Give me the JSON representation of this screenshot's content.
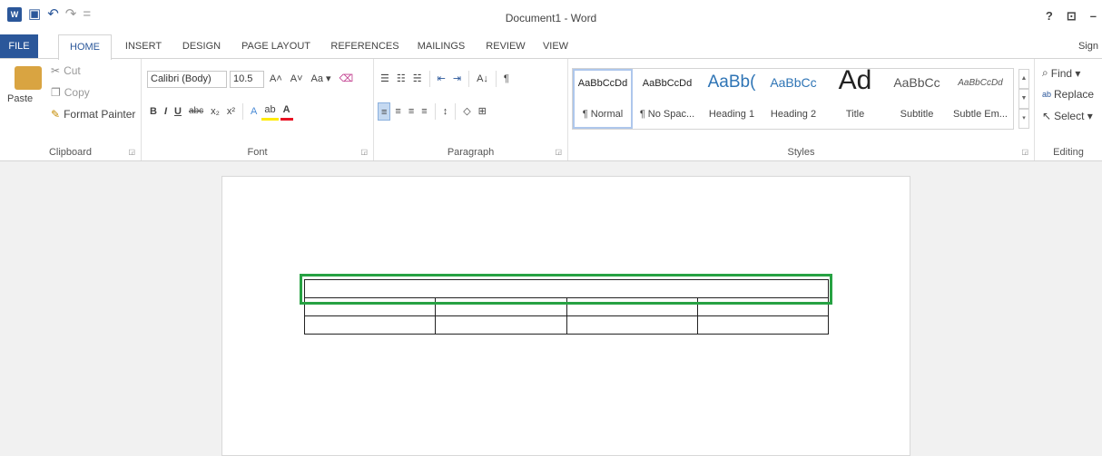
{
  "window": {
    "title": "Document1 - Word",
    "controls": [
      "?",
      "⊡",
      "–"
    ]
  },
  "qat": {
    "app_icon": "W",
    "save_icon": "💾",
    "undo_icon": "↶",
    "redo_icon": "↷",
    "customize_icon": "="
  },
  "tabs": {
    "file": "FILE",
    "home": "HOME",
    "insert": "INSERT",
    "design": "DESIGN",
    "page_layout": "PAGE LAYOUT",
    "references": "REFERENCES",
    "mailings": "MAILINGS",
    "review": "REVIEW",
    "view": "VIEW",
    "signin": "Sign"
  },
  "clipboard": {
    "paste": "Paste",
    "cut": "Cut",
    "copy": "Copy",
    "format_painter": "Format Painter",
    "label": "Clipboard"
  },
  "font": {
    "name": "Calibri (Body)",
    "size": "10.5",
    "grow": "A˄",
    "shrink": "A˅",
    "case": "Aa ▾",
    "clear": "⌫",
    "bold": "B",
    "italic": "I",
    "underline": "U",
    "strike": "abc",
    "sub": "x₂",
    "sup": "x²",
    "effects": "A",
    "highlight": "ab",
    "color": "A",
    "label": "Font"
  },
  "paragraph": {
    "bullets": "☰",
    "numbering": "☷",
    "multilevel": "☵",
    "decrease": "⇤",
    "increase": "⇥",
    "sort": "A↓",
    "show": "¶",
    "left": "≡",
    "center": "≡",
    "right": "≡",
    "justify": "≡",
    "spacing": "↕",
    "shading": "◇",
    "borders": "⊞",
    "label": "Paragraph"
  },
  "styles": {
    "items": [
      {
        "preview": "AaBbCcDd",
        "name": "¶ Normal"
      },
      {
        "preview": "AaBbCcDd",
        "name": "¶ No Spac..."
      },
      {
        "preview": "AaBb(",
        "name": "Heading 1"
      },
      {
        "preview": "AaBbCc",
        "name": "Heading 2"
      },
      {
        "preview": "Ad",
        "name": "Title"
      },
      {
        "preview": "AaBbCc",
        "name": "Subtitle"
      },
      {
        "preview": "AaBbCcDd",
        "name": "Subtle Em..."
      }
    ],
    "label": "Styles"
  },
  "editing": {
    "find": "Find ▾",
    "replace": "Replace",
    "select": "Select ▾",
    "label": "Editing"
  },
  "colors": {
    "accent": "#2b579a",
    "highlight_box": "#27a243"
  }
}
